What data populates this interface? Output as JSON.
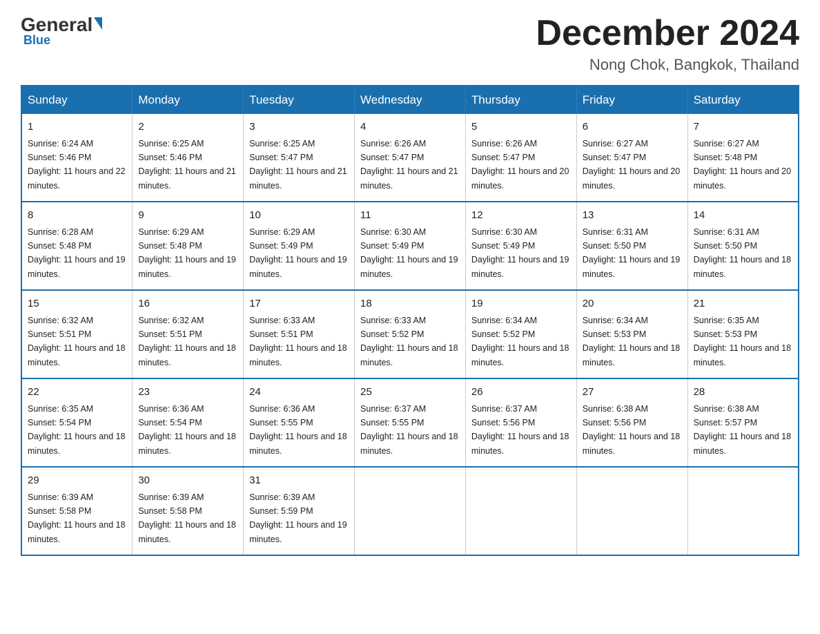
{
  "logo": {
    "general": "General",
    "triangle": "",
    "blue": "Blue"
  },
  "title": {
    "month": "December 2024",
    "location": "Nong Chok, Bangkok, Thailand"
  },
  "days_of_week": [
    "Sunday",
    "Monday",
    "Tuesday",
    "Wednesday",
    "Thursday",
    "Friday",
    "Saturday"
  ],
  "weeks": [
    [
      {
        "day": "1",
        "sunrise": "Sunrise: 6:24 AM",
        "sunset": "Sunset: 5:46 PM",
        "daylight": "Daylight: 11 hours and 22 minutes."
      },
      {
        "day": "2",
        "sunrise": "Sunrise: 6:25 AM",
        "sunset": "Sunset: 5:46 PM",
        "daylight": "Daylight: 11 hours and 21 minutes."
      },
      {
        "day": "3",
        "sunrise": "Sunrise: 6:25 AM",
        "sunset": "Sunset: 5:47 PM",
        "daylight": "Daylight: 11 hours and 21 minutes."
      },
      {
        "day": "4",
        "sunrise": "Sunrise: 6:26 AM",
        "sunset": "Sunset: 5:47 PM",
        "daylight": "Daylight: 11 hours and 21 minutes."
      },
      {
        "day": "5",
        "sunrise": "Sunrise: 6:26 AM",
        "sunset": "Sunset: 5:47 PM",
        "daylight": "Daylight: 11 hours and 20 minutes."
      },
      {
        "day": "6",
        "sunrise": "Sunrise: 6:27 AM",
        "sunset": "Sunset: 5:47 PM",
        "daylight": "Daylight: 11 hours and 20 minutes."
      },
      {
        "day": "7",
        "sunrise": "Sunrise: 6:27 AM",
        "sunset": "Sunset: 5:48 PM",
        "daylight": "Daylight: 11 hours and 20 minutes."
      }
    ],
    [
      {
        "day": "8",
        "sunrise": "Sunrise: 6:28 AM",
        "sunset": "Sunset: 5:48 PM",
        "daylight": "Daylight: 11 hours and 19 minutes."
      },
      {
        "day": "9",
        "sunrise": "Sunrise: 6:29 AM",
        "sunset": "Sunset: 5:48 PM",
        "daylight": "Daylight: 11 hours and 19 minutes."
      },
      {
        "day": "10",
        "sunrise": "Sunrise: 6:29 AM",
        "sunset": "Sunset: 5:49 PM",
        "daylight": "Daylight: 11 hours and 19 minutes."
      },
      {
        "day": "11",
        "sunrise": "Sunrise: 6:30 AM",
        "sunset": "Sunset: 5:49 PM",
        "daylight": "Daylight: 11 hours and 19 minutes."
      },
      {
        "day": "12",
        "sunrise": "Sunrise: 6:30 AM",
        "sunset": "Sunset: 5:49 PM",
        "daylight": "Daylight: 11 hours and 19 minutes."
      },
      {
        "day": "13",
        "sunrise": "Sunrise: 6:31 AM",
        "sunset": "Sunset: 5:50 PM",
        "daylight": "Daylight: 11 hours and 19 minutes."
      },
      {
        "day": "14",
        "sunrise": "Sunrise: 6:31 AM",
        "sunset": "Sunset: 5:50 PM",
        "daylight": "Daylight: 11 hours and 18 minutes."
      }
    ],
    [
      {
        "day": "15",
        "sunrise": "Sunrise: 6:32 AM",
        "sunset": "Sunset: 5:51 PM",
        "daylight": "Daylight: 11 hours and 18 minutes."
      },
      {
        "day": "16",
        "sunrise": "Sunrise: 6:32 AM",
        "sunset": "Sunset: 5:51 PM",
        "daylight": "Daylight: 11 hours and 18 minutes."
      },
      {
        "day": "17",
        "sunrise": "Sunrise: 6:33 AM",
        "sunset": "Sunset: 5:51 PM",
        "daylight": "Daylight: 11 hours and 18 minutes."
      },
      {
        "day": "18",
        "sunrise": "Sunrise: 6:33 AM",
        "sunset": "Sunset: 5:52 PM",
        "daylight": "Daylight: 11 hours and 18 minutes."
      },
      {
        "day": "19",
        "sunrise": "Sunrise: 6:34 AM",
        "sunset": "Sunset: 5:52 PM",
        "daylight": "Daylight: 11 hours and 18 minutes."
      },
      {
        "day": "20",
        "sunrise": "Sunrise: 6:34 AM",
        "sunset": "Sunset: 5:53 PM",
        "daylight": "Daylight: 11 hours and 18 minutes."
      },
      {
        "day": "21",
        "sunrise": "Sunrise: 6:35 AM",
        "sunset": "Sunset: 5:53 PM",
        "daylight": "Daylight: 11 hours and 18 minutes."
      }
    ],
    [
      {
        "day": "22",
        "sunrise": "Sunrise: 6:35 AM",
        "sunset": "Sunset: 5:54 PM",
        "daylight": "Daylight: 11 hours and 18 minutes."
      },
      {
        "day": "23",
        "sunrise": "Sunrise: 6:36 AM",
        "sunset": "Sunset: 5:54 PM",
        "daylight": "Daylight: 11 hours and 18 minutes."
      },
      {
        "day": "24",
        "sunrise": "Sunrise: 6:36 AM",
        "sunset": "Sunset: 5:55 PM",
        "daylight": "Daylight: 11 hours and 18 minutes."
      },
      {
        "day": "25",
        "sunrise": "Sunrise: 6:37 AM",
        "sunset": "Sunset: 5:55 PM",
        "daylight": "Daylight: 11 hours and 18 minutes."
      },
      {
        "day": "26",
        "sunrise": "Sunrise: 6:37 AM",
        "sunset": "Sunset: 5:56 PM",
        "daylight": "Daylight: 11 hours and 18 minutes."
      },
      {
        "day": "27",
        "sunrise": "Sunrise: 6:38 AM",
        "sunset": "Sunset: 5:56 PM",
        "daylight": "Daylight: 11 hours and 18 minutes."
      },
      {
        "day": "28",
        "sunrise": "Sunrise: 6:38 AM",
        "sunset": "Sunset: 5:57 PM",
        "daylight": "Daylight: 11 hours and 18 minutes."
      }
    ],
    [
      {
        "day": "29",
        "sunrise": "Sunrise: 6:39 AM",
        "sunset": "Sunset: 5:58 PM",
        "daylight": "Daylight: 11 hours and 18 minutes."
      },
      {
        "day": "30",
        "sunrise": "Sunrise: 6:39 AM",
        "sunset": "Sunset: 5:58 PM",
        "daylight": "Daylight: 11 hours and 18 minutes."
      },
      {
        "day": "31",
        "sunrise": "Sunrise: 6:39 AM",
        "sunset": "Sunset: 5:59 PM",
        "daylight": "Daylight: 11 hours and 19 minutes."
      },
      null,
      null,
      null,
      null
    ]
  ]
}
